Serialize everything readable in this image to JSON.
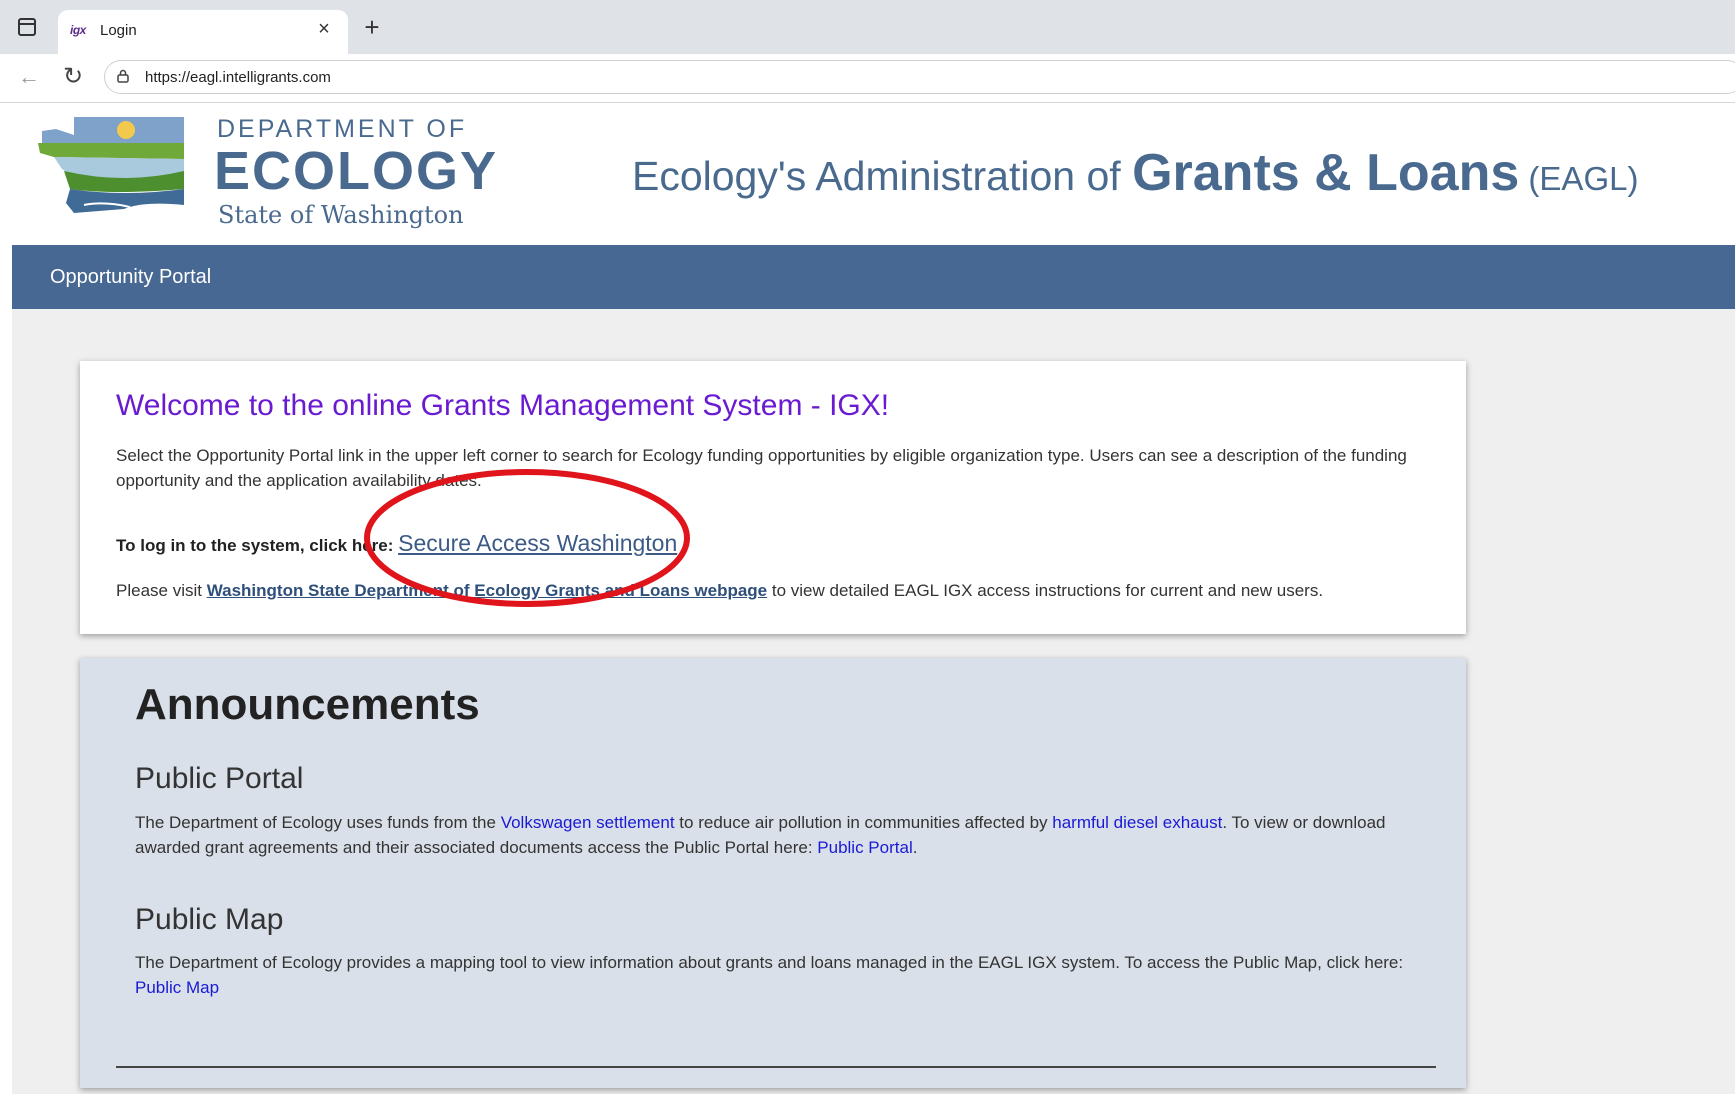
{
  "browser": {
    "tab_title": "Login",
    "tab_favicon": "igx",
    "tab_close": "×",
    "new_tab": "+",
    "url": "https://eagl.intelligrants.com"
  },
  "header": {
    "logo": {
      "line1": "DEPARTMENT OF",
      "line2": "ECOLOGY",
      "line3": "State of Washington"
    },
    "title_prefix": "Ecology's Administration of ",
    "title_main": "Grants & Loans",
    "title_abbr": " (EAGL)"
  },
  "nav": {
    "opportunity_portal": "Opportunity Portal"
  },
  "welcome": {
    "title": "Welcome to the online Grants Management System - IGX!",
    "description": "Select the Opportunity Portal link in the upper left corner to search for Ecology funding opportunities by eligible organization type. Users can see a description of the funding opportunity and the application availability dates.",
    "login_prefix": "To log in to the system, click here: ",
    "login_link": "Secure Access Washington",
    "visit_prefix": "Please visit ",
    "visit_link": "Washington State Department of Ecology Grants and Loans webpage",
    "visit_suffix": " to view detailed EAGL IGX access instructions for current and new users."
  },
  "announcements": {
    "title": "Announcements",
    "public_portal": {
      "heading": "Public Portal",
      "text1": "The Department of Ecology uses funds from the ",
      "link1": "Volkswagen settlement",
      "text2": " to reduce air pollution in communities affected by ",
      "link2": "harmful diesel exhaust",
      "text3": ". To view or download awarded grant agreements and their associated documents access the Public Portal here: ",
      "link3": "Public Portal",
      "text4": "."
    },
    "public_map": {
      "heading": "Public Map",
      "text1": "The Department of Ecology provides a mapping tool to view information about grants and loans managed in the EAGL IGX system. To access the Public Map, click here: ",
      "link1": "Public Map"
    }
  },
  "colors": {
    "brand_blue": "#476893",
    "welcome_title": "#6a1bd1",
    "highlight_circle": "#e0141b"
  }
}
